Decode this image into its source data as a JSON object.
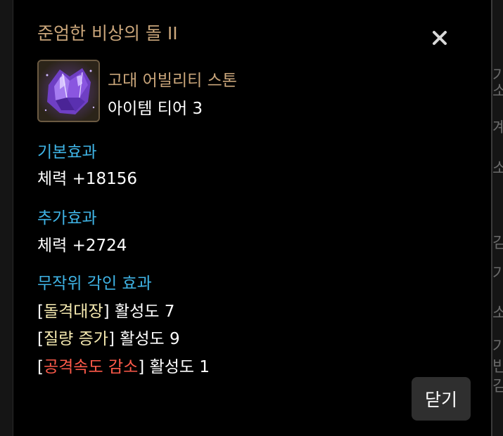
{
  "background": {
    "fragments": [
      "기",
      "소",
      "계",
      "소",
      "김",
      "기",
      "소",
      "기",
      "빈",
      "김"
    ]
  },
  "modal": {
    "title": "준엄한 비상의 돌 II",
    "close_icon": "close-icon",
    "item": {
      "icon": "crystal-stone-icon",
      "type": "고대 어빌리티 스톤",
      "tier": "아이템 티어 3"
    },
    "base_effect": {
      "title": "기본효과",
      "line": "체력 +18156"
    },
    "extra_effect": {
      "title": "추가효과",
      "line": "체력 +2724"
    },
    "random_engraving": {
      "title": "무작위 각인 효과",
      "items": [
        {
          "open": "[",
          "name": "돌격대장",
          "close": "]",
          "level": " 활성도 7",
          "color": "#f5e9b0"
        },
        {
          "open": "[",
          "name": "질량 증가",
          "close": "]",
          "level": " 활성도 9",
          "color": "#f5e9b0"
        },
        {
          "open": "[",
          "name": "공격속도 감소",
          "close": "]",
          "level": " 활성도 1",
          "color": "#ff5a4a"
        }
      ]
    },
    "close_button_label": "닫기"
  },
  "colors": {
    "title": "#c9a57a",
    "section": "#3fb4e6",
    "positive_engraving": "#f5e9b0",
    "negative_engraving": "#ff5a4a",
    "modal_background": "#000000",
    "button_background": "#2f2f2f"
  }
}
